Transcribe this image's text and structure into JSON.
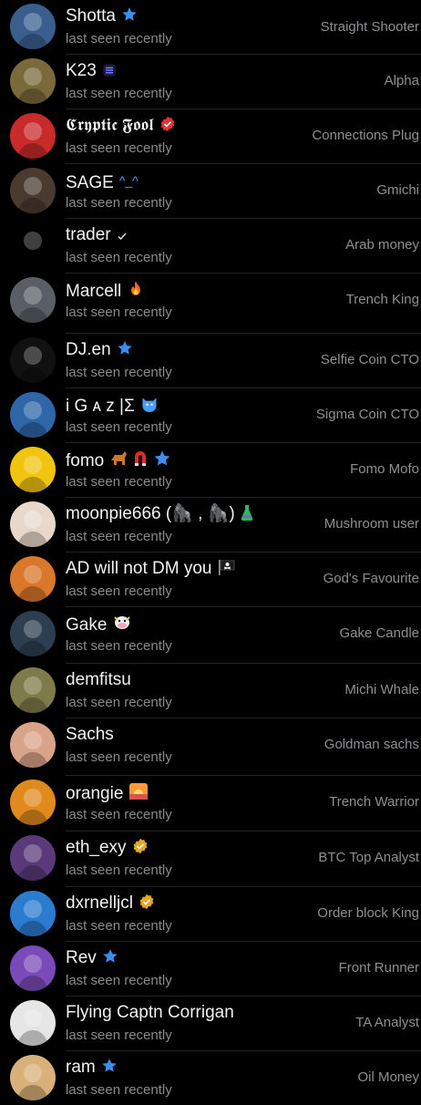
{
  "members": [
    {
      "name": "Shotta",
      "status": "last seen recently",
      "role": "Straight Shooter",
      "badge": "star-icon",
      "avatar_color": "#3a5f8f"
    },
    {
      "name": "K23",
      "status": "last seen recently",
      "role": "Alpha",
      "badge": "lines-emoji-icon",
      "avatar_color": "#7a6a3a"
    },
    {
      "name": "𝕮𝖗𝖞𝖕𝖙𝖎𝖈 𝕱𝖔𝖔𝖑",
      "status": "last seen recently",
      "role": "Connections Plug",
      "badge": "verified-red-icon",
      "avatar_color": "#c92a2a"
    },
    {
      "name": "SAGE",
      "status": "last seen recently",
      "role": "Gmichi",
      "badge": "text-emoticon",
      "badge_text": "^_^",
      "avatar_color": "#4a3a30"
    },
    {
      "name": "trader",
      "status": "last seen recently",
      "role": "Arab money",
      "badge": "check-icon",
      "avatar_color": "#000000"
    },
    {
      "name": "Marcell",
      "status": "last seen recently",
      "role": "Trench King",
      "badge": "fire-emoji-icon",
      "avatar_color": "#5a5f66"
    },
    {
      "name": "DJ.en",
      "status": "last seen recently",
      "role": "Selfie Coin CTO",
      "badge": "star-icon",
      "avatar_color": "#111111"
    },
    {
      "name": "i G ᴀ z |Σ",
      "status": "last seen recently",
      "role": "Sigma Coin CTO",
      "badge": "cat-emoji-icon",
      "avatar_color": "#2f66a8"
    },
    {
      "name": "fomo",
      "status": "last seen recently",
      "role": "Fomo Mofo",
      "badge": "dog-magnet-star-icon",
      "avatar_color": "#f1c40f"
    },
    {
      "name": "moonpie666 (🦍 , 🦍)",
      "status": "last seen recently",
      "role": "Mushroom user",
      "badge": "flask-emoji-icon",
      "avatar_color": "#e8d8cc"
    },
    {
      "name": "AD will not DM you",
      "status": "last seen recently",
      "role": "God's Favourite",
      "badge": "pirate-flag-icon",
      "avatar_color": "#d9772a"
    },
    {
      "name": "Gake",
      "status": "last seen recently",
      "role": "Gake Candle",
      "badge": "cow-emoji-icon",
      "avatar_color": "#2c3e50"
    },
    {
      "name": "demfitsu",
      "status": "last seen recently",
      "role": "Michi Whale",
      "badge": "",
      "avatar_color": "#7f7a4a"
    },
    {
      "name": "Sachs",
      "status": "last seen recently",
      "role": "Goldman sachs",
      "badge": "",
      "avatar_color": "#d9a38a"
    },
    {
      "name": "orangie",
      "status": "last seen recently",
      "role": "Trench Warrior",
      "badge": "sunrise-emoji-icon",
      "avatar_color": "#e08a1e"
    },
    {
      "name": "eth_exy",
      "status": "last seen recently",
      "role": "BTC Top Analyst",
      "badge": "verified-gold-icon",
      "avatar_color": "#5a3a7a"
    },
    {
      "name": "dxrnelljcl",
      "status": "last seen recently",
      "role": "Order block King",
      "badge": "verified-gold-icon",
      "avatar_color": "#2b7bd1"
    },
    {
      "name": "Rev",
      "status": "last seen recently",
      "role": "Front Runner",
      "badge": "star-icon",
      "avatar_color": "#7a4bb8"
    },
    {
      "name": "Flying Captn Corrigan",
      "status": "last seen recently",
      "role": "TA Analyst",
      "badge": "",
      "avatar_color": "#e6e6e6"
    },
    {
      "name": "ram",
      "status": "last seen recently",
      "role": "Oil Money",
      "badge": "star-icon",
      "avatar_color": "#d8b07a"
    }
  ]
}
